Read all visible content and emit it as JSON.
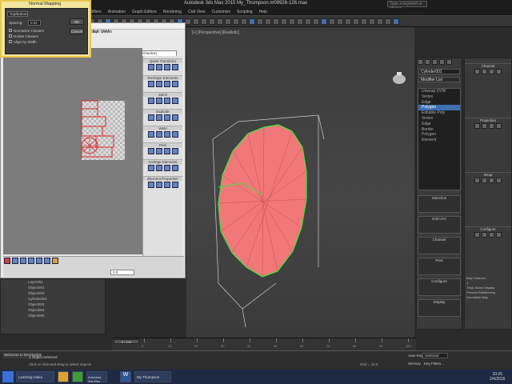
{
  "app": {
    "title": "Autodesk 3ds Max 2015 My_Thompson.m09926-126.max",
    "search_placeholder": "Type a keyword or phrase",
    "menu": [
      "Edit",
      "Tools",
      "Group",
      "Views",
      "Create",
      "Modifiers",
      "Animation",
      "Graph Editors",
      "Rendering",
      "Civil View",
      "Customize",
      "Scripting",
      "Help"
    ]
  },
  "dialog_mapping": {
    "title": "Normal Mapping",
    "dropdown": "Top/Bottom",
    "spacing_label": "Spacing:",
    "spacing_value": "0.02",
    "options": [
      "Normalize Clusters",
      "Rotate Clusters",
      "Align by Width"
    ],
    "ok_label": "OK",
    "cancel_label": "Cancel"
  },
  "dialog_unwrap": {
    "title": "Edit UVWs",
    "menu": [
      "File",
      "Edit",
      "Select",
      "Tools",
      "Mapping",
      "Options",
      "Display",
      "View"
    ],
    "channel_label": "UV",
    "checker_label": "CheckerPattern (Checker)",
    "sections": [
      "Quick Transform",
      "Reshape Elements",
      "Stitch",
      "Explode",
      "Weld",
      "Peel",
      "Arrange Elements",
      "Element Properties"
    ],
    "arrange": {
      "rescale": "Rescale",
      "rotate": "Rotate",
      "padding": "Padding"
    },
    "bottom_value": "0.0"
  },
  "scene_explorer": {
    "items": [
      "Object001",
      "Object002",
      "Cylinder001",
      "Object003",
      "Object004",
      "Object005"
    ],
    "root": "Layer001"
  },
  "viewport": {
    "label": "[+] [Perspective] [Realistic]"
  },
  "command_panel": {
    "object_name": "Cylinder001",
    "modifier_list": "Modifier List",
    "stack": [
      "Unwrap UVW",
      "Vertex",
      "Edge",
      "Polygon",
      "Editable Poly",
      "Vertex",
      "Edge",
      "Border",
      "Polygon",
      "Element"
    ],
    "selected_index": 3,
    "rollouts": [
      "Selection",
      "Edit UVs",
      "Channel",
      "Peel",
      "Configure",
      "Display"
    ],
    "channel_value": "Reset UVWs",
    "open_uv_editor": "Open UV Editor ..."
  },
  "right_panel": {
    "sections": [
      "Channel",
      "Projection",
      "Wrap",
      "Configure"
    ],
    "map_channel_label": "Map Channel:",
    "map_channel_value": "1",
    "thick_seam": "Thick Seam Display",
    "prevent_reflattening": "Prevent Reflattening",
    "normalize_map": "Normalize Map"
  },
  "timeline": {
    "frame": "0 / 100",
    "ticks": [
      "0",
      "10",
      "20",
      "30",
      "40",
      "50",
      "60",
      "70",
      "80",
      "90",
      "100"
    ]
  },
  "statusbar": {
    "script": "Welcome to MAXScript.",
    "selection": "1 Object Selected",
    "hint": "Click or click-and-drag to select objects",
    "grid": "Grid = 10.0",
    "auto_key": "Auto Key",
    "selected": "Selected",
    "set_key": "Set Key",
    "key_filters": "Key Filters..."
  },
  "taskbar": {
    "items": [
      "Learning Video",
      "Autodesk 3ds Max",
      "Microsoft Word",
      "My Thompson"
    ],
    "clock_time": "10:26",
    "clock_date": "2/4/2016"
  },
  "colors": {
    "accent": "#3e6fb0",
    "mesh": "#f07070",
    "uv_red": "#e02020",
    "dialog_highlight": "#e7c84a"
  }
}
